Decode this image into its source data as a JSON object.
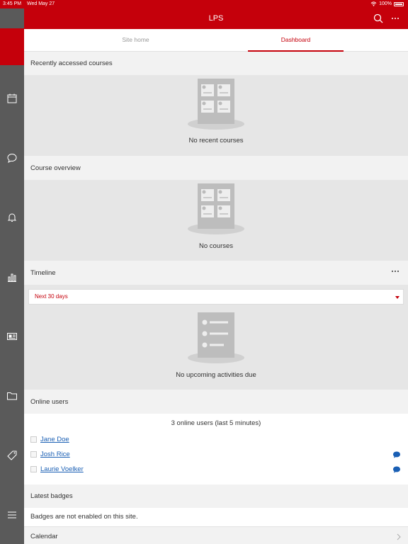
{
  "status_bar": {
    "time": "3:45 PM",
    "date": "Wed May 27",
    "battery": "100%"
  },
  "header": {
    "title": "LPS"
  },
  "tabs": [
    {
      "label": "Site home"
    },
    {
      "label": "Dashboard"
    }
  ],
  "sidebar": {
    "items": [
      "home-icon",
      "calendar-icon",
      "chat-icon",
      "bell-icon",
      "chart-icon",
      "news-icon",
      "folder-icon",
      "tag-icon",
      "menu-icon"
    ]
  },
  "sections": {
    "recent": {
      "title": "Recently accessed courses",
      "empty": "No recent courses"
    },
    "overview": {
      "title": "Course overview",
      "empty": "No courses"
    },
    "timeline": {
      "title": "Timeline",
      "filter": "Next 30 days",
      "empty": "No upcoming activities due"
    },
    "online": {
      "title": "Online users",
      "summary": "3 online users (last 5 minutes)",
      "users": [
        {
          "name": "Jane Doe"
        },
        {
          "name": "Josh Rice"
        },
        {
          "name": "Laurie Voelker"
        }
      ]
    },
    "badges": {
      "title": "Latest badges",
      "message": "Badges are not enabled on this site."
    },
    "calendar": {
      "title": "Calendar"
    }
  },
  "colors": {
    "brand": "#c5000b",
    "sidebar": "#5a5a5a",
    "link": "#1a5fb4"
  }
}
